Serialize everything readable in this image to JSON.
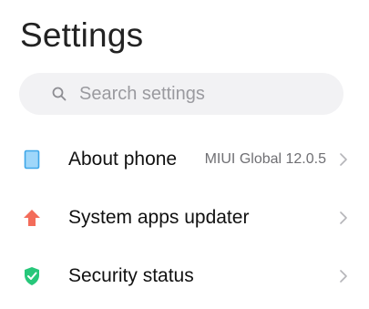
{
  "page_title": "Settings",
  "search": {
    "placeholder": "Search settings",
    "icon": "search-icon"
  },
  "items": [
    {
      "label": "About phone",
      "value": "MIUI Global 12.0.5",
      "icon": "phone-icon",
      "icon_color": "#5cb6f0"
    },
    {
      "label": "System apps updater",
      "value": "",
      "icon": "arrow-up-icon",
      "icon_color": "#f36c5a"
    },
    {
      "label": "Security status",
      "value": "",
      "icon": "shield-check-icon",
      "icon_color": "#27c77a"
    }
  ],
  "colors": {
    "background": "#ffffff",
    "search_bg": "#f2f2f4",
    "chevron": "#b5b5b9"
  }
}
